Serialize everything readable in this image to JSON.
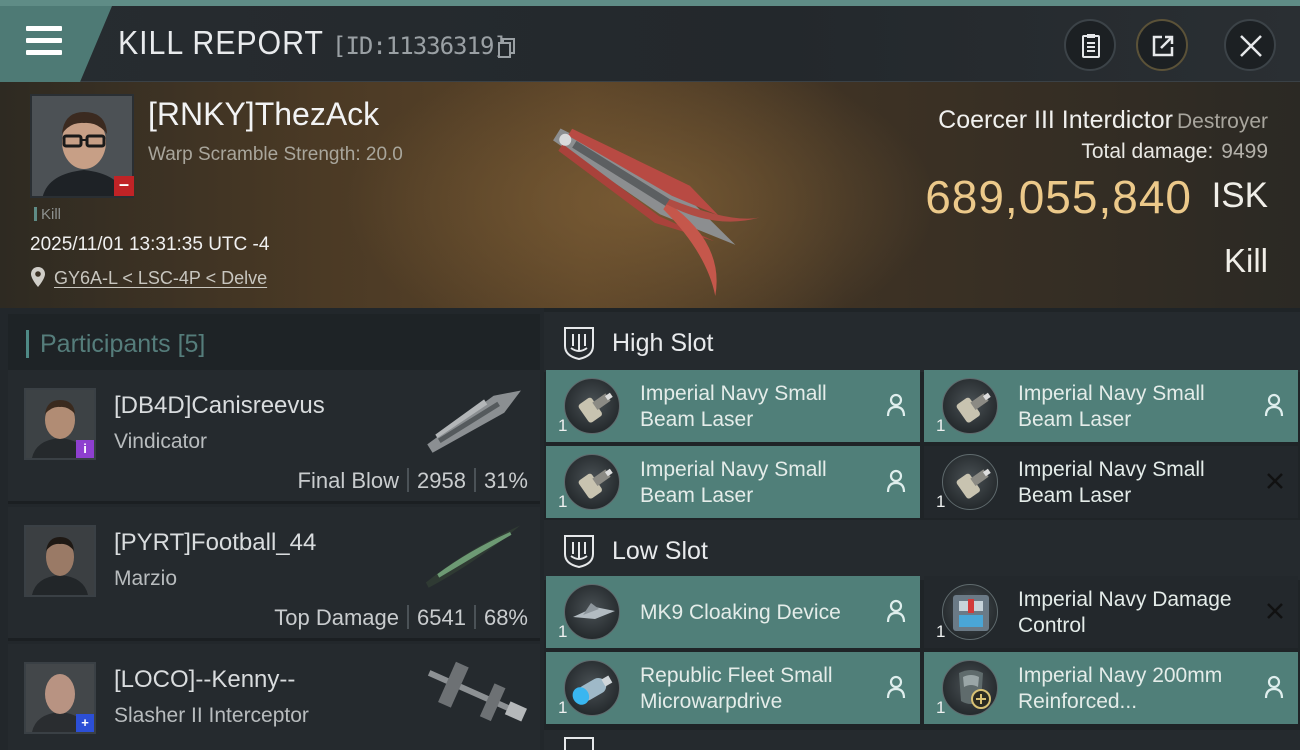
{
  "header": {
    "title": "KILL REPORT",
    "report_id": "[ID:11336319]"
  },
  "victim": {
    "name": "[RNKY]ThezAck",
    "warp_scramble": "Warp Scramble Strength: 20.0",
    "tag": "Kill",
    "timestamp": "2025/11/01 13:31:35 UTC -4",
    "location": "GY6A-L < LSC-4P < Delve",
    "ship_name": "Coercer III Interdictor",
    "ship_class": "Destroyer",
    "total_damage_label": "Total damage:",
    "total_damage": "9499",
    "isk_value": "689,055,840",
    "isk_unit": "ISK",
    "result": "Kill",
    "colors": {
      "isk": "#ecc98a",
      "security_badge": "#c02326"
    }
  },
  "participants": {
    "title": "Participants",
    "count": "[5]",
    "rows": [
      {
        "name": "[DB4D]Canisreevus",
        "ship": "Vindicator",
        "role": "Final Blow",
        "damage": "2958",
        "percent": "31%",
        "badge_color": "#8e3fcf",
        "badge": "i"
      },
      {
        "name": "[PYRT]Football_44",
        "ship": "Marzio",
        "role": "Top Damage",
        "damage": "6541",
        "percent": "68%",
        "badge_color": "",
        "badge": ""
      },
      {
        "name": "[LOCO]--Kenny--",
        "ship": "Slasher II Interceptor",
        "role": "",
        "damage": "",
        "percent": "",
        "badge_color": "#2c4fd6",
        "badge": "+"
      }
    ]
  },
  "fitting": {
    "high_slot": {
      "title": "High Slot",
      "modules": [
        {
          "name": "Imperial Navy Small Beam Laser",
          "qty": "1",
          "status": "pilot"
        },
        {
          "name": "Imperial Navy Small Beam Laser",
          "qty": "1",
          "status": "pilot"
        },
        {
          "name": "Imperial Navy Small Beam Laser",
          "qty": "1",
          "status": "pilot"
        },
        {
          "name": "Imperial Navy Small Beam Laser",
          "qty": "1",
          "status": "destroyed"
        }
      ]
    },
    "low_slot": {
      "title": "Low Slot",
      "modules": [
        {
          "name": "MK9 Cloaking Device",
          "qty": "1",
          "status": "pilot"
        },
        {
          "name": "Imperial Navy Damage Control",
          "qty": "1",
          "status": "destroyed"
        },
        {
          "name": "Republic Fleet Small Microwarpdrive",
          "qty": "1",
          "status": "pilot"
        },
        {
          "name": "Imperial Navy 200mm Reinforced...",
          "qty": "1",
          "status": "pilot"
        }
      ]
    },
    "colors": {
      "dropped": "#507f79",
      "destroyed": "#23282c"
    }
  }
}
